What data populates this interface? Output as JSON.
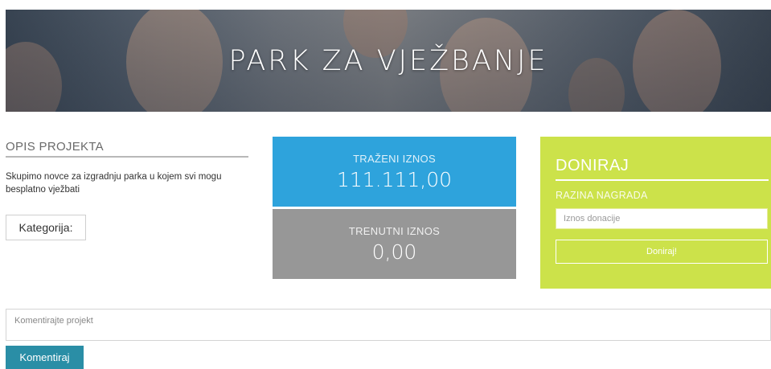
{
  "hero": {
    "title": "PARK ZA VJEŽBANJE"
  },
  "description": {
    "heading": "OPIS PROJEKTA",
    "text": "Skupimo novce za izgradnju parka u kojem svi mogu besplatno vježbati",
    "category_label": "Kategorija:"
  },
  "amounts": {
    "required_label": "TRAŽENI IZNOS",
    "required_value": "111.111,00",
    "current_label": "TRENUTNI IZNOS",
    "current_value": "0,00"
  },
  "donate": {
    "title": "DONIRAJ",
    "reward_label": "RAZINA NAGRADA",
    "amount_placeholder": "Iznos donacije",
    "button_label": "Doniraj!"
  },
  "comment": {
    "placeholder": "Komentirajte projekt",
    "button_label": "Komentiraj"
  },
  "colors": {
    "required_box": "#2ea3dc",
    "current_box": "#979797",
    "donate_panel": "#cce24a",
    "comment_button": "#2a8ea6"
  }
}
